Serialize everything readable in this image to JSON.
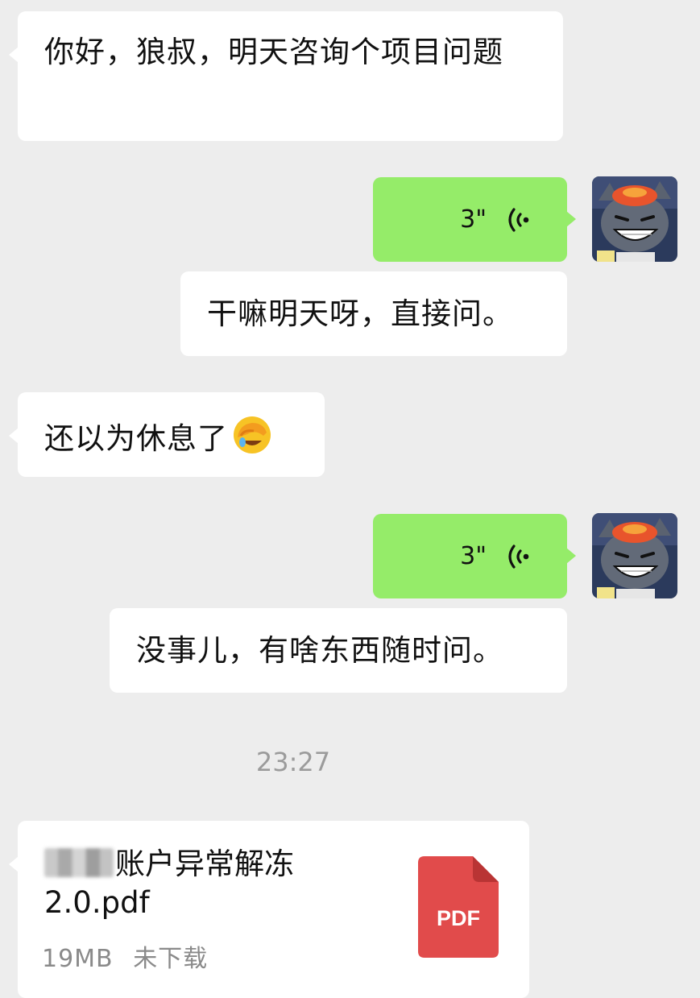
{
  "messages": [
    {
      "id": "m1",
      "side": "left",
      "type": "text",
      "text": "你好，狼叔，明天咨询个项目问题"
    },
    {
      "id": "m2",
      "side": "right",
      "type": "voice",
      "duration": "3\""
    },
    {
      "id": "m3",
      "side": "right",
      "type": "text",
      "text": "干嘛明天呀，直接问。"
    },
    {
      "id": "m4",
      "side": "left",
      "type": "text",
      "text": "还以为休息了",
      "emoji": "face-palm-emoji"
    },
    {
      "id": "m5",
      "side": "right",
      "type": "voice",
      "duration": "3\""
    },
    {
      "id": "m6",
      "side": "right",
      "type": "text",
      "text": "没事儿，有啥东西随时问。"
    }
  ],
  "timestamp": "23:27",
  "file": {
    "name": "账户异常解冻2.0.pdf",
    "size": "19MB",
    "status": "未下载",
    "icon_label": "PDF"
  },
  "colors": {
    "background": "#ededed",
    "incoming_bubble": "#ffffff",
    "outgoing_bubble": "#95ec69",
    "pdf_red": "#e14b4b"
  },
  "icons": [
    "voice-wave-icon",
    "avatar",
    "face-palm-emoji",
    "pdf-file-icon"
  ]
}
